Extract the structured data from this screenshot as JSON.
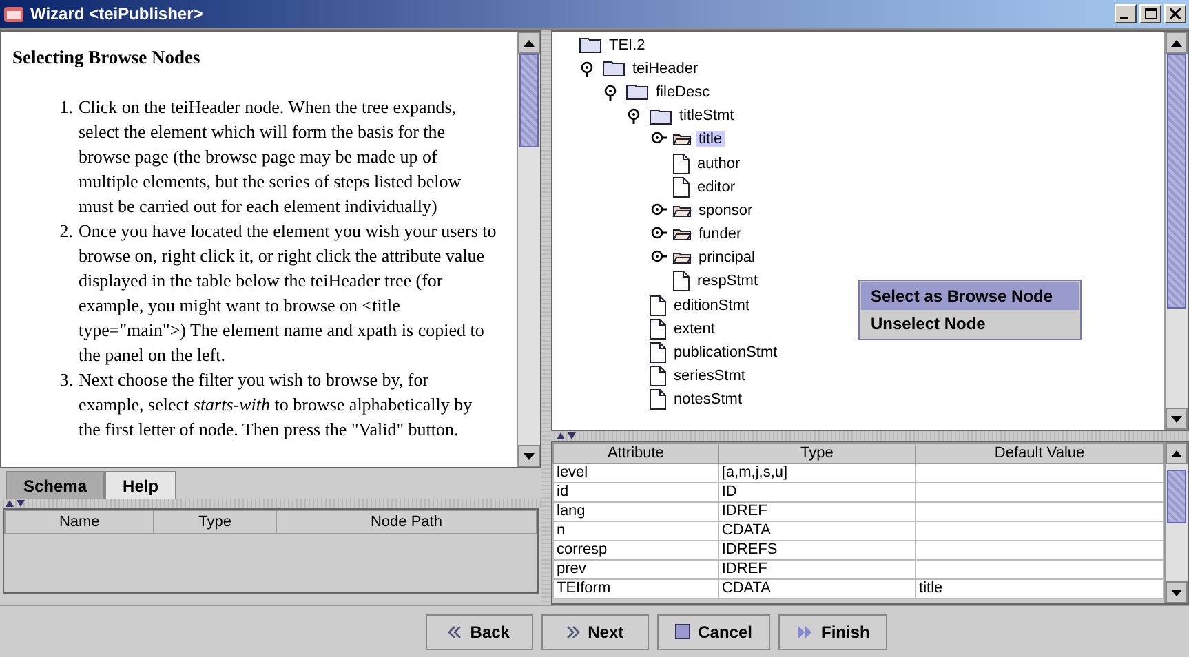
{
  "window": {
    "title": "Wizard <teiPublisher>"
  },
  "help": {
    "heading": "Selecting Browse Nodes",
    "steps": [
      {
        "marker": "1.",
        "text": "Click on the teiHeader node. When the tree expands, select the element which will form the basis for the browse page (the browse page may be made up of multiple elements, but the series of steps listed below must be carried out for each element individually)"
      },
      {
        "marker": "2.",
        "text": "Once you have located the element you wish your users to browse on, right click it, or right click the attribute value displayed in the table below the teiHeader tree (for example, you might want to browse on <title type=\"main\">) The element name and xpath is copied to the panel on the left."
      },
      {
        "marker": "3.",
        "text": "Next choose the filter you wish to browse by, for example, select *starts-with* to browse alphabetically by the first letter of node. Then press the \"Valid\" button."
      }
    ]
  },
  "tabs": [
    {
      "label": "Schema",
      "selected": false
    },
    {
      "label": "Help",
      "selected": true
    }
  ],
  "nodes_table": {
    "columns": [
      "Name",
      "Type",
      "Node Path"
    ]
  },
  "tree": [
    {
      "label": "TEI.2",
      "kind": "folder",
      "selected": false,
      "children": [
        {
          "label": "teiHeader",
          "kind": "folder",
          "expanded": true,
          "selected": false,
          "children": [
            {
              "label": "fileDesc",
              "kind": "folder",
              "expanded": true,
              "selected": false,
              "children": [
                {
                  "label": "titleStmt",
                  "kind": "folder",
                  "expanded": true,
                  "selected": false,
                  "children": [
                    {
                      "label": "title",
                      "kind": "element",
                      "expanded": false,
                      "selected": true
                    },
                    {
                      "label": "author",
                      "kind": "leaf",
                      "selected": false
                    },
                    {
                      "label": "editor",
                      "kind": "leaf",
                      "selected": false
                    },
                    {
                      "label": "sponsor",
                      "kind": "element",
                      "expanded": false,
                      "selected": false
                    },
                    {
                      "label": "funder",
                      "kind": "element",
                      "expanded": false,
                      "selected": false
                    },
                    {
                      "label": "principal",
                      "kind": "element",
                      "expanded": false,
                      "selected": false
                    },
                    {
                      "label": "respStmt",
                      "kind": "leaf",
                      "selected": false
                    }
                  ]
                },
                {
                  "label": "editionStmt",
                  "kind": "leaf",
                  "selected": false
                },
                {
                  "label": "extent",
                  "kind": "leaf",
                  "selected": false
                },
                {
                  "label": "publicationStmt",
                  "kind": "leaf",
                  "selected": false
                },
                {
                  "label": "seriesStmt",
                  "kind": "leaf",
                  "selected": false
                },
                {
                  "label": "notesStmt",
                  "kind": "leaf",
                  "selected": false
                }
              ]
            }
          ]
        }
      ]
    }
  ],
  "context_menu": [
    {
      "label": "Select as Browse Node",
      "selected": true
    },
    {
      "label": "Unselect Node",
      "selected": false
    }
  ],
  "attributes_table": {
    "columns": [
      "Attribute",
      "Type",
      "Default Value"
    ],
    "rows": [
      [
        "level",
        "[a,m,j,s,u]",
        ""
      ],
      [
        "id",
        "ID",
        ""
      ],
      [
        "lang",
        "IDREF",
        ""
      ],
      [
        "n",
        "CDATA",
        ""
      ],
      [
        "corresp",
        "IDREFS",
        ""
      ],
      [
        "prev",
        "IDREF",
        ""
      ],
      [
        "TEIform",
        "CDATA",
        "title"
      ]
    ]
  },
  "buttons": [
    {
      "label": "Back",
      "kind": "back"
    },
    {
      "label": "Next",
      "kind": "next"
    },
    {
      "label": "Cancel",
      "kind": "cancel"
    },
    {
      "label": "Finish",
      "kind": "finish"
    }
  ]
}
